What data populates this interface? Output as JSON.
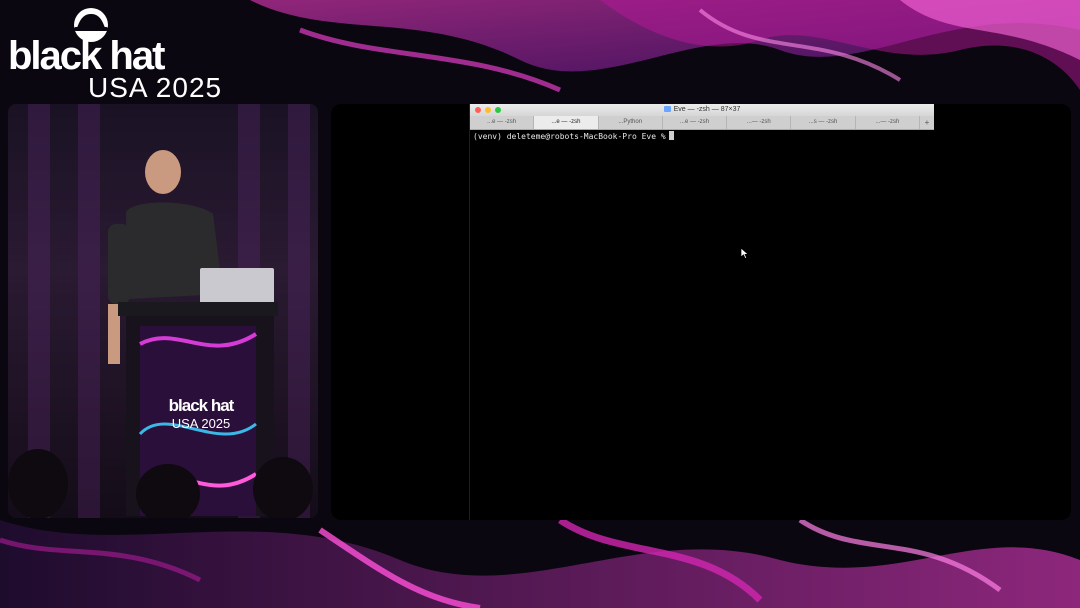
{
  "branding": {
    "word": "black hat",
    "event": "USA 2025"
  },
  "podium": {
    "word": "black hat",
    "event": "USA 2025"
  },
  "terminal": {
    "window_title": "Eve — -zsh — 87×37",
    "tabs": [
      {
        "label": "...e — -zsh",
        "active": false
      },
      {
        "label": "...e — -zsh",
        "active": true
      },
      {
        "label": "...Python",
        "active": false
      },
      {
        "label": "...e — -zsh",
        "active": false
      },
      {
        "label": "...— -zsh",
        "active": false
      },
      {
        "label": "...s — -zsh",
        "active": false
      },
      {
        "label": "...— -zsh",
        "active": false
      }
    ],
    "plus_label": "+",
    "prompt": "(venv) deleteme@robots-MacBook-Pro Eve %"
  },
  "colors": {
    "accent_magenta": "#d629b8",
    "close": "#ff5f57",
    "minimize": "#febc2e",
    "zoom": "#28c840"
  },
  "icons": {
    "hat": "black-hat-logo-icon",
    "cursor": "mouse-pointer-icon"
  }
}
